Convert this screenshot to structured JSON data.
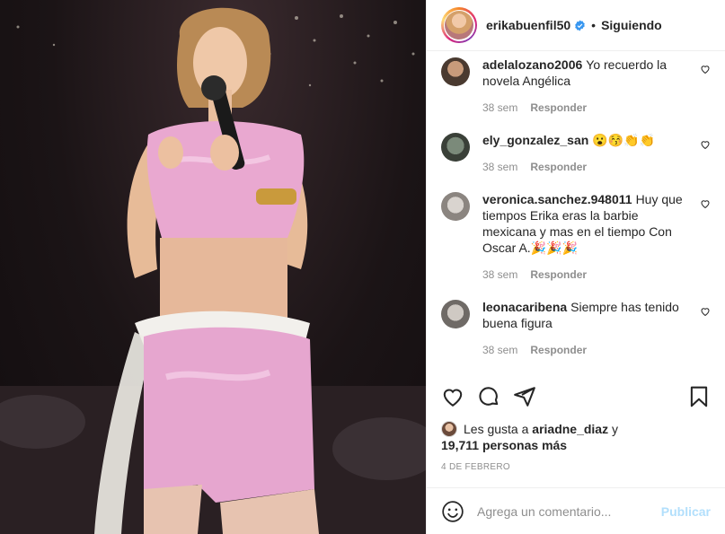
{
  "header": {
    "username": "erikabuenfil50",
    "separator": "•",
    "follow_status": "Siguiendo"
  },
  "comments": [
    {
      "username": "adelalozano2006",
      "text": "Yo recuerdo la novela Angélica",
      "time": "38 sem",
      "reply_label": "Responder"
    },
    {
      "username": "ely_gonzalez_san",
      "text": "😮😚👏👏",
      "time": "38 sem",
      "reply_label": "Responder"
    },
    {
      "username": "veronica.sanchez.948011",
      "text": "Huy que tiempos Erika eras la barbie mexicana y mas en el tiempo Con Oscar A.🎉🎉🎉",
      "time": "38 sem",
      "reply_label": "Responder"
    },
    {
      "username": "leonacaribena",
      "text": "Siempre has tenido buena figura",
      "time": "38 sem",
      "reply_label": "Responder"
    }
  ],
  "likes": {
    "prefix": "Les gusta a",
    "liker": "ariadne_diaz",
    "conjunction": "y",
    "others": "19,711 personas más"
  },
  "date": "4 DE FEBRERO",
  "add_comment": {
    "placeholder": "Agrega un comentario...",
    "publish_label": "Publicar"
  },
  "colors": {
    "verified": "#3897f0",
    "publish_disabled": "#b2dffc",
    "muted": "#8e8e8e"
  },
  "icons": [
    "heart-icon",
    "comment-icon",
    "share-icon",
    "bookmark-icon",
    "emoji-icon",
    "verified-icon"
  ]
}
